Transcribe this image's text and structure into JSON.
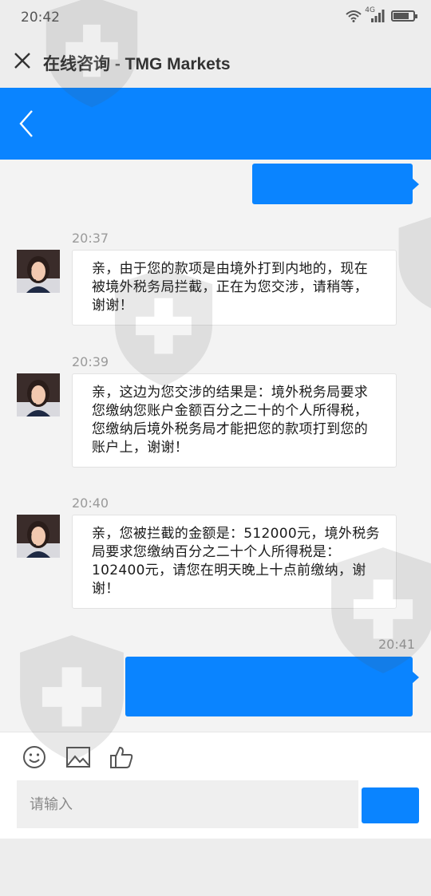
{
  "status_bar": {
    "time": "20:42",
    "network": "4G",
    "battery_level": 0.72
  },
  "title_bar": {
    "title": "在线咨询",
    "separator": " - ",
    "subtitle": "TMG Markets"
  },
  "messages": [
    {
      "time": "20:37",
      "text": "亲，由于您的款项是由境外打到内地的，现在被境外税务局拦截，正在为您交涉，请稍等，谢谢！"
    },
    {
      "time": "20:39",
      "text": "亲，这边为您交涉的结果是：境外税务局要求您缴纳您账户金额百分之二十的个人所得税，您缴纳后境外税务局才能把您的款项打到您的账户上，谢谢！"
    },
    {
      "time": "20:40",
      "text": "亲，您被拦截的金额是：512000元，境外税务局要求您缴纳百分之二十个人所得税是：102400元，请您在明天晚上十点前缴纳，谢谢！"
    }
  ],
  "outgoing_time": "20:41",
  "input": {
    "placeholder": "请输入",
    "value": ""
  },
  "colors": {
    "accent": "#0a84ff"
  },
  "icons": [
    "close-icon",
    "back-icon",
    "emoji-icon",
    "image-icon",
    "thumbs-up-icon",
    "wifi-icon",
    "signal-icon",
    "battery-icon"
  ]
}
